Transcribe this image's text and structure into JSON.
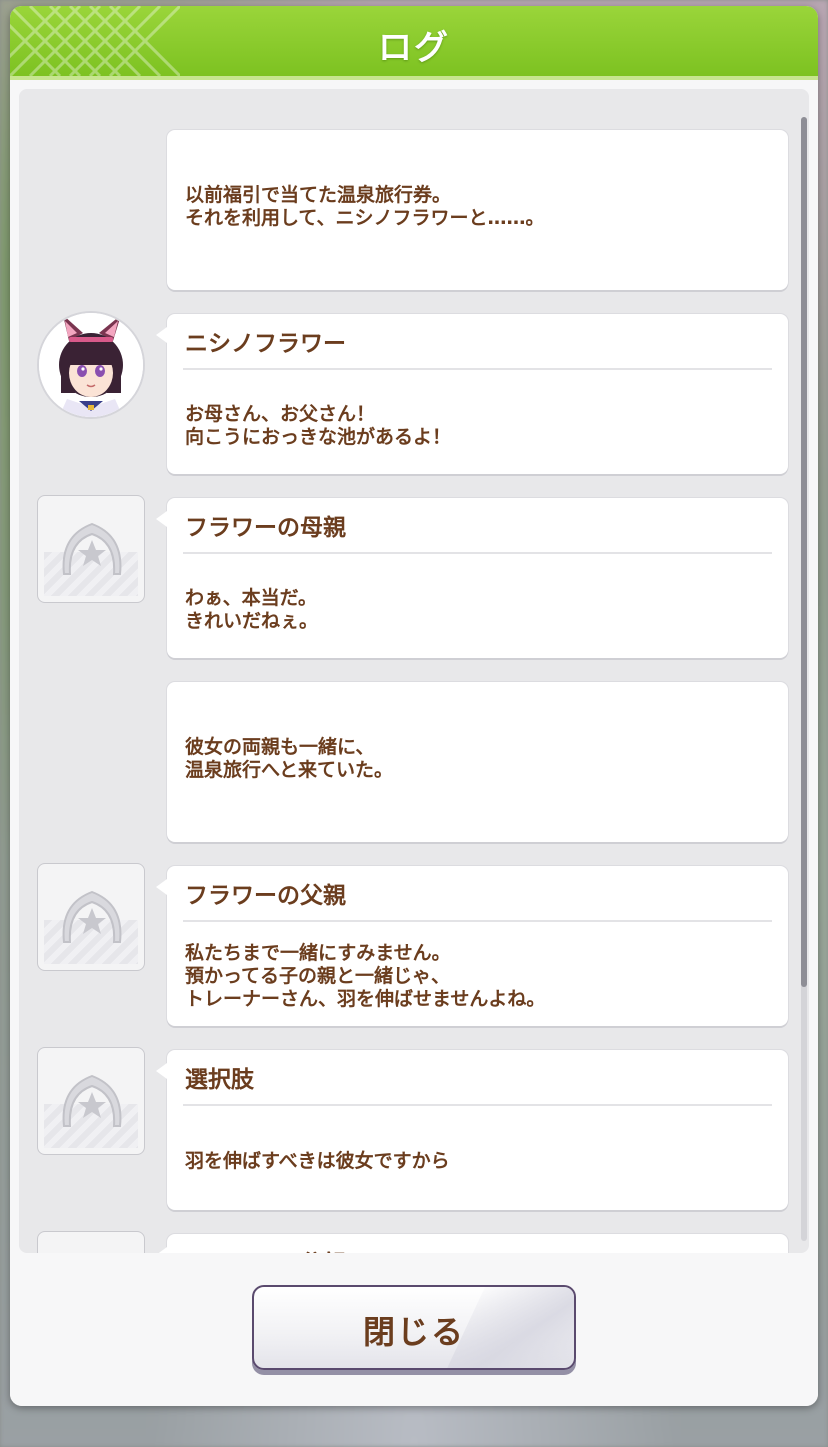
{
  "dialog": {
    "title": "ログ",
    "close_label": "閉じる"
  },
  "entries": [
    {
      "speaker": "",
      "avatar": "none",
      "text": "以前福引で当てた温泉旅行券。\nそれを利用して、ニシノフラワーと……。"
    },
    {
      "speaker": "ニシノフラワー",
      "avatar": "character-portrait",
      "text": "お母さん、お父さん！\n向こうにおっきな池があるよ！"
    },
    {
      "speaker": "フラワーの母親",
      "avatar": "horseshoe-placeholder-icon",
      "text": "わぁ、本当だ。\nきれいだねぇ。"
    },
    {
      "speaker": "",
      "avatar": "none",
      "text": "彼女の両親も一緒に、\n温泉旅行へと来ていた。"
    },
    {
      "speaker": "フラワーの父親",
      "avatar": "horseshoe-placeholder-icon",
      "text": "私たちまで一緒にすみません。\n預かってる子の親と一緒じゃ、\nトレーナーさん、羽を伸ばせませんよね。"
    },
    {
      "speaker": "選択肢",
      "avatar": "horseshoe-placeholder-icon",
      "text": "羽を伸ばすべきは彼女ですから"
    },
    {
      "speaker": "フラワーの父親",
      "avatar": "horseshoe-placeholder-icon",
      "text": ""
    }
  ],
  "colors": {
    "header_green": "#8ccd2e",
    "text_brown": "#6b3d1e",
    "button_border": "#5a4a6e"
  }
}
